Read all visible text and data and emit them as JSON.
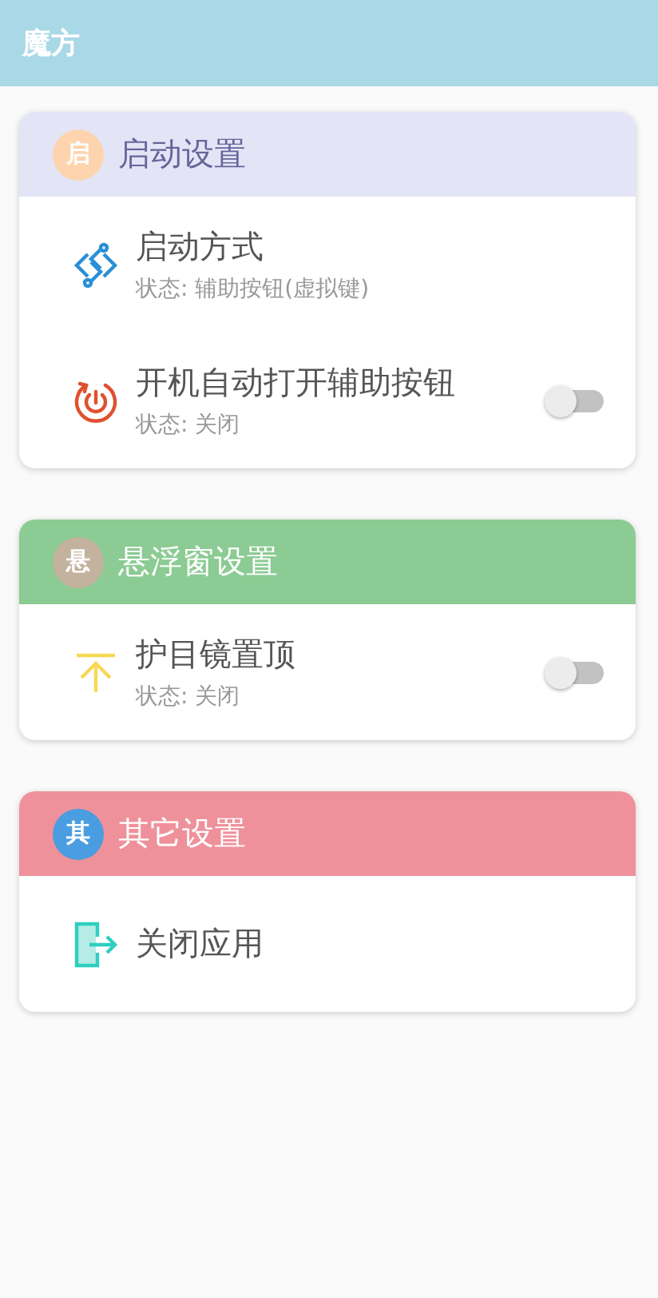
{
  "app_bar": {
    "title": "魔方"
  },
  "sections": [
    {
      "badge": {
        "text": "启",
        "color": "#fdd4ad"
      },
      "title": "启动设置",
      "color": "#e4e4f7",
      "items": [
        {
          "kind": "link",
          "title": "启动方式",
          "status": "状态: 辅助按钮(虚拟键)"
        },
        {
          "kind": "switch",
          "title": "开机自动打开辅助按钮",
          "status": "状态: 关闭",
          "on": false
        }
      ]
    },
    {
      "badge": {
        "text": "悬",
        "color": "#c3b29d"
      },
      "title": "悬浮窗设置",
      "color": "#8ccb93",
      "items": [
        {
          "kind": "switch",
          "title": "护目镜置顶",
          "status": "状态: 关闭",
          "on": false
        }
      ]
    },
    {
      "badge": {
        "text": "其",
        "color": "#4a9de0"
      },
      "title": "其它设置",
      "color": "#ef919b",
      "items": [
        {
          "kind": "link",
          "title": "关闭应用"
        }
      ]
    }
  ]
}
